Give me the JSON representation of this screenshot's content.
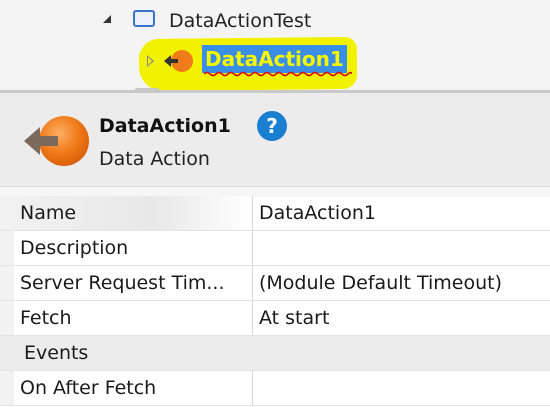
{
  "tree": {
    "root_label": "DataActionTest",
    "child_label": "DataAction1"
  },
  "header": {
    "title": "DataAction1",
    "subtitle": "Data Action",
    "help_glyph": "?"
  },
  "properties": {
    "rows": [
      {
        "name": "Name",
        "value": "DataAction1"
      },
      {
        "name": "Description",
        "value": ""
      },
      {
        "name": "Server Request Tim...",
        "value": "(Module Default Timeout)"
      },
      {
        "name": "Fetch",
        "value": "At start"
      }
    ],
    "category": "Events",
    "events": [
      {
        "name": "On After Fetch",
        "value": ""
      }
    ]
  },
  "colors": {
    "highlight": "#f2f200",
    "selection": "#3a8ee6",
    "action_orange": "#f07b1a",
    "help_blue": "#1b7fd1"
  },
  "icons": {
    "tree_expanded": "triangle-down-icon",
    "tree_collapsed": "triangle-right-icon",
    "screen": "screen-icon",
    "data_action": "data-action-icon",
    "help": "help-icon"
  }
}
